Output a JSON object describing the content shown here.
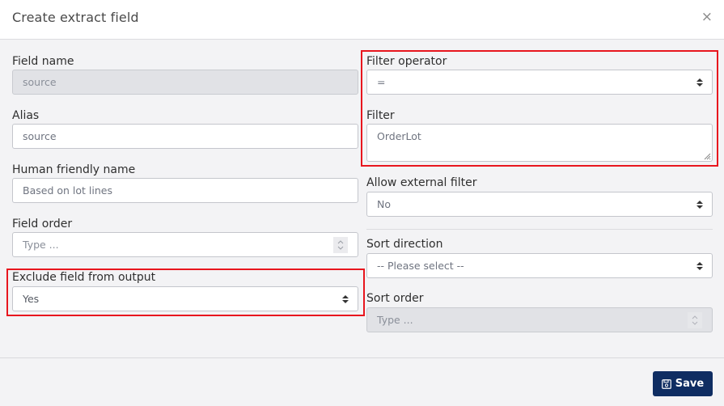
{
  "dialog": {
    "title": "Create extract field",
    "close_icon": "×"
  },
  "left": {
    "field_name": {
      "label": "Field name",
      "value": "source",
      "disabled": true
    },
    "alias": {
      "label": "Alias",
      "value": "source"
    },
    "human_name": {
      "label": "Human friendly name",
      "value": "Based on lot lines"
    },
    "field_order": {
      "label": "Field order",
      "placeholder": "Type ..."
    },
    "exclude": {
      "label": "Exclude field from output",
      "value": "Yes"
    }
  },
  "right": {
    "filter_operator": {
      "label": "Filter operator",
      "value": "="
    },
    "filter": {
      "label": "Filter",
      "value": "OrderLot"
    },
    "allow_external": {
      "label": "Allow external filter",
      "value": "No"
    },
    "sort_direction": {
      "label": "Sort direction",
      "value": "-- Please select --"
    },
    "sort_order": {
      "label": "Sort order",
      "placeholder": "Type ...",
      "disabled": true
    }
  },
  "footer": {
    "save_label": "Save",
    "save_icon": "floppy-disk-icon"
  },
  "colors": {
    "primary": "#0f2d62",
    "highlight": "#e8161e",
    "background": "#f3f3f5"
  }
}
